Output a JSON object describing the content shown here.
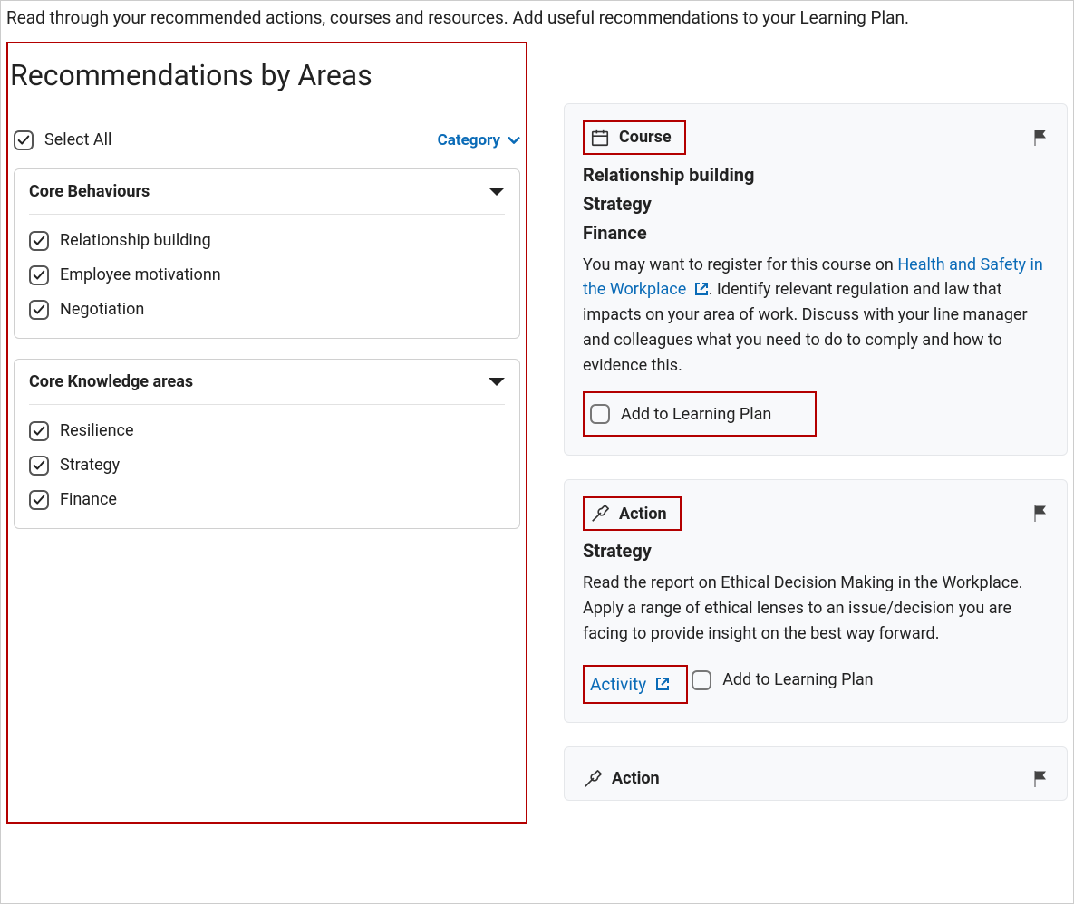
{
  "intro": "Read through your recommended actions, courses and resources. Add useful recommendations to your Learning Plan.",
  "left": {
    "title": "Recommendations by Areas",
    "selectAll": "Select All",
    "categoryLabel": "Category",
    "groups": [
      {
        "title": "Core Behaviours",
        "items": [
          "Relationship building",
          "Employee motivationn",
          "Negotiation"
        ]
      },
      {
        "title": "Core Knowledge areas",
        "items": [
          "Resilience",
          "Strategy",
          "Finance"
        ]
      }
    ]
  },
  "right": {
    "cards": [
      {
        "type": "Course",
        "icon": "calendar",
        "tags": [
          "Relationship building",
          "Strategy",
          "Finance"
        ],
        "bodyPre": "You may want to register for this course on ",
        "linkText": "Health and Safety in the Workplace",
        "bodyPost": ". Identify relevant regulation and law that impacts on your area of work. Discuss with your line manager and colleagues what you need to do to comply and  how to evidence this.",
        "addLabel": "Add to Learning Plan",
        "addHighlighted": true,
        "typeHighlighted": true
      },
      {
        "type": "Action",
        "icon": "wrench",
        "tags": [
          "Strategy"
        ],
        "bodyPlain": "Read the  report on Ethical Decision Making in the Workplace. Apply a range of ethical lenses to an issue/decision you are facing to provide insight on the best way forward.",
        "activityLink": "Activity",
        "addLabel": "Add to Learning Plan",
        "addHighlighted": false,
        "typeHighlighted": true
      },
      {
        "type": "Action",
        "icon": "wrench",
        "tags": [],
        "bodyPlain": "",
        "addLabel": "",
        "typeHighlighted": false
      }
    ]
  }
}
